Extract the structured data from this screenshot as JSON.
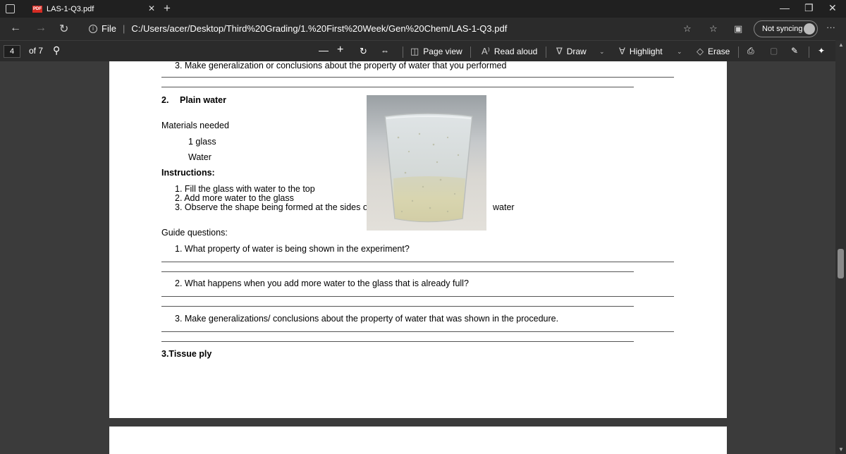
{
  "browser": {
    "tab_title": "LAS-1-Q3.pdf",
    "tab_badge": "PDF",
    "url_scheme": "File",
    "url": "C:/Users/acer/Desktop/Third%20Grading/1.%20First%20Week/Gen%20Chem/LAS-1-Q3.pdf",
    "sync_label": "Not syncing",
    "more_label": "···"
  },
  "pdf_toolbar": {
    "page_number": "4",
    "page_total": "of 7",
    "page_view_label": "Page view",
    "read_aloud_label": "Read aloud",
    "draw_label": "Draw",
    "highlight_label": "Highlight",
    "erase_label": "Erase"
  },
  "document": {
    "top_item": "3.  Make generalization or conclusions about the property of water that you performed",
    "section_number": "2.",
    "section_title": "Plain water",
    "materials_heading": "Materials needed",
    "materials": [
      "1 glass",
      "Water"
    ],
    "instructions_heading": "Instructions:",
    "instructions": [
      "1.  Fill the glass with water to the top",
      "2.  Add more water to the glass",
      "3.  Observe the shape being formed at the sides of"
    ],
    "instruction_continued": "water",
    "guide_heading": "Guide questions:",
    "questions": [
      "1.  What property of water is being shown in the experiment?",
      "2.  What happens when you add more water to the glass that is already full?",
      "3.  Make generalizations/ conclusions about the property of water that was shown in the procedure."
    ],
    "next_section": "3.Tissue ply"
  }
}
